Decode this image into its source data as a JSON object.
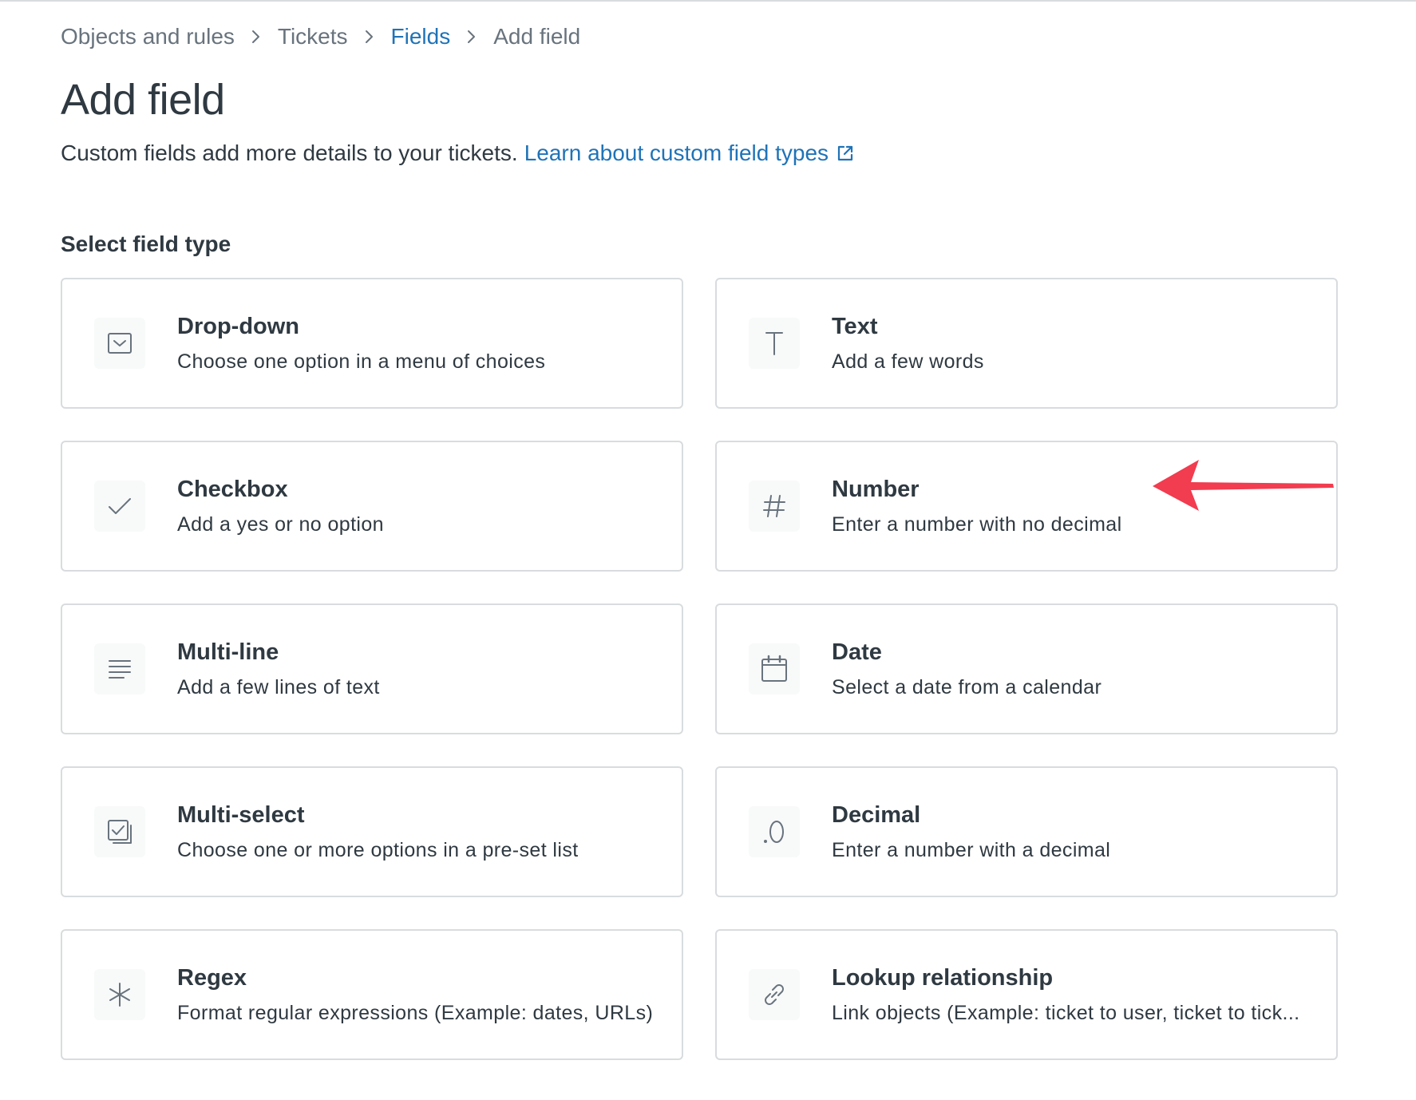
{
  "breadcrumb": {
    "items": [
      {
        "label": "Objects and rules"
      },
      {
        "label": "Tickets"
      },
      {
        "label": "Fields"
      },
      {
        "label": "Add field"
      }
    ]
  },
  "header": {
    "title": "Add field",
    "subtitle": "Custom fields add more details to your tickets.",
    "learn_link": "Learn about custom field types"
  },
  "section": {
    "label": "Select field type"
  },
  "field_types": [
    {
      "title": "Drop-down",
      "desc": "Choose one option in a menu of choices",
      "icon": "dropdown-icon"
    },
    {
      "title": "Text",
      "desc": "Add a few words",
      "icon": "text-icon"
    },
    {
      "title": "Checkbox",
      "desc": "Add a yes or no option",
      "icon": "checkmark-icon"
    },
    {
      "title": "Number",
      "desc": "Enter a number with no decimal",
      "icon": "hash-icon"
    },
    {
      "title": "Multi-line",
      "desc": "Add a few lines of text",
      "icon": "lines-icon"
    },
    {
      "title": "Date",
      "desc": "Select a date from a calendar",
      "icon": "calendar-icon"
    },
    {
      "title": "Multi-select",
      "desc": "Choose one or more options in a pre-set list",
      "icon": "multi-select-icon"
    },
    {
      "title": "Decimal",
      "desc": "Enter a number with a decimal",
      "icon": "decimal-icon"
    },
    {
      "title": "Regex",
      "desc": "Format regular expressions (Example: dates, URLs)",
      "icon": "asterisk-icon"
    },
    {
      "title": "Lookup relationship",
      "desc": "Link objects (Example: ticket to user, ticket to tick...",
      "icon": "link-icon"
    }
  ],
  "colors": {
    "link": "#1f73b7",
    "text": "#2f3941",
    "muted": "#68737d",
    "border": "#d8dcde",
    "annotation_arrow": "#f23c4f"
  }
}
